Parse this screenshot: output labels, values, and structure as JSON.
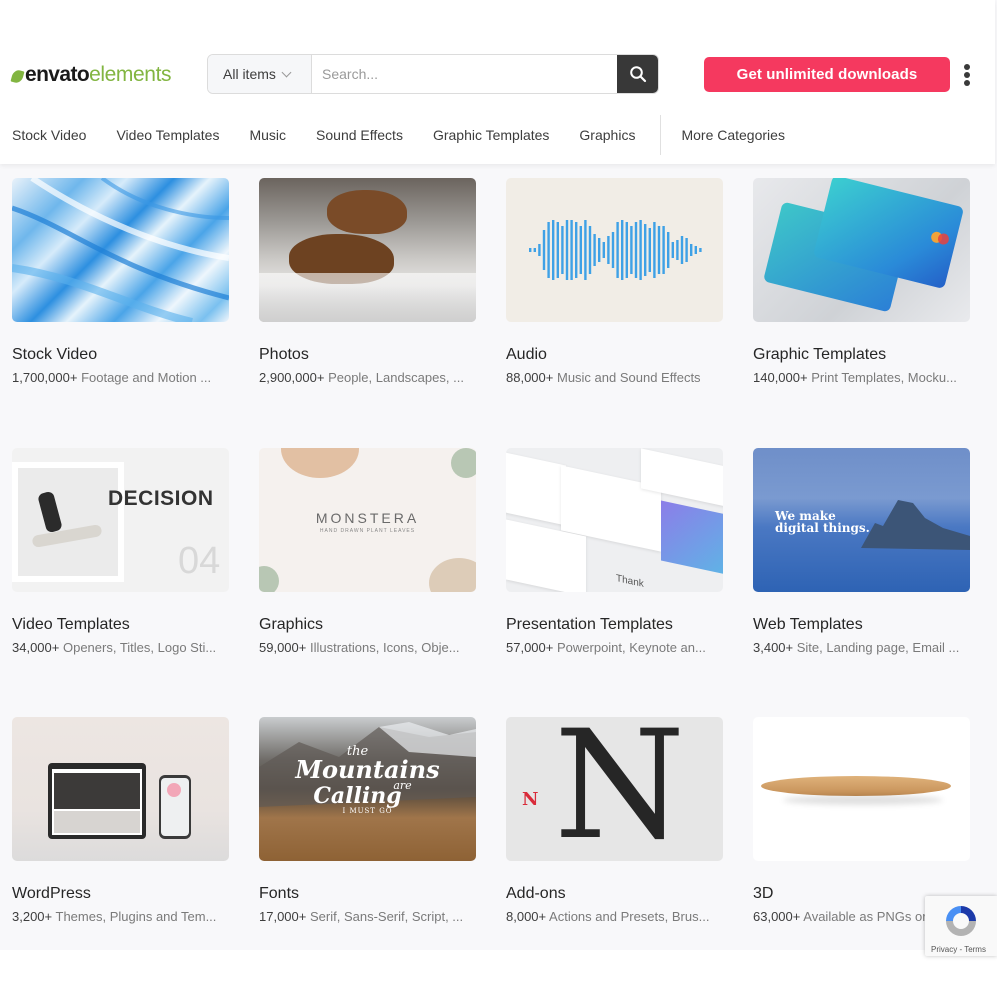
{
  "header": {
    "logo": {
      "word1": "envato",
      "word2": "elements"
    },
    "search": {
      "scope": "All items",
      "placeholder": "Search..."
    },
    "cta_label": "Get unlimited downloads"
  },
  "nav": {
    "items": [
      "Stock Video",
      "Video Templates",
      "Music",
      "Sound Effects",
      "Graphic Templates",
      "Graphics"
    ],
    "more": "More Categories"
  },
  "categories": [
    {
      "title": "Stock Video",
      "count": "1,700,000+",
      "desc": "Footage and Motion ..."
    },
    {
      "title": "Photos",
      "count": "2,900,000+",
      "desc": "People, Landscapes, ..."
    },
    {
      "title": "Audio",
      "count": "88,000+",
      "desc": "Music and Sound Effects"
    },
    {
      "title": "Graphic Templates",
      "count": "140,000+",
      "desc": "Print Templates, Mocku..."
    },
    {
      "title": "Video Templates",
      "count": "34,000+",
      "desc": "Openers, Titles, Logo Sti..."
    },
    {
      "title": "Graphics",
      "count": "59,000+",
      "desc": "Illustrations, Icons, Obje..."
    },
    {
      "title": "Presentation Templates",
      "count": "57,000+",
      "desc": "Powerpoint, Keynote an..."
    },
    {
      "title": "Web Templates",
      "count": "3,400+",
      "desc": "Site, Landing page, Email ..."
    },
    {
      "title": "WordPress",
      "count": "3,200+",
      "desc": "Themes, Plugins and Tem..."
    },
    {
      "title": "Fonts",
      "count": "17,000+",
      "desc": "Serif, Sans-Serif, Script, ..."
    },
    {
      "title": "Add-ons",
      "count": "8,000+",
      "desc": "Actions and Presets, Brus..."
    },
    {
      "title": "3D",
      "count": "63,000+",
      "desc": "Available as PNGs or..."
    }
  ],
  "thumb_text": {
    "decision": "DECISION",
    "decision_num": "04",
    "monstera": "MONSTERA",
    "monstera_sub": "HAND DRAWN PLANT LEAVES",
    "web": "We make digital things.",
    "fonts_1": "the",
    "fonts_2": "Mountains",
    "fonts_3": "are",
    "fonts_4": "Calling",
    "fonts_5": "I MUST GO",
    "addons_letter": "N",
    "present_thanks": "Thank"
  },
  "recaptcha": {
    "text": "Privacy - Terms"
  },
  "colors": {
    "brand_green": "#82b541",
    "cta": "#f5395f",
    "search_button": "#383838"
  }
}
